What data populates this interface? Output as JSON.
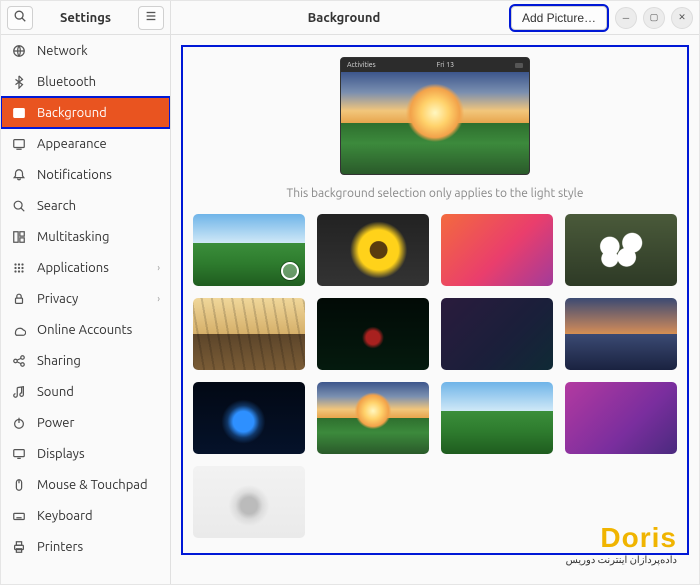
{
  "sidebar": {
    "title": "Settings",
    "items": [
      {
        "label": "Network",
        "icon": "network-icon"
      },
      {
        "label": "Bluetooth",
        "icon": "bluetooth-icon"
      },
      {
        "label": "Background",
        "icon": "background-icon",
        "selected": true
      },
      {
        "label": "Appearance",
        "icon": "appearance-icon"
      },
      {
        "label": "Notifications",
        "icon": "notifications-icon"
      },
      {
        "label": "Search",
        "icon": "search-icon"
      },
      {
        "label": "Multitasking",
        "icon": "multitasking-icon"
      },
      {
        "label": "Applications",
        "icon": "applications-icon",
        "has_submenu": true
      },
      {
        "label": "Privacy",
        "icon": "privacy-icon",
        "has_submenu": true
      },
      {
        "label": "Online Accounts",
        "icon": "online-accounts-icon"
      },
      {
        "label": "Sharing",
        "icon": "sharing-icon"
      },
      {
        "label": "Sound",
        "icon": "sound-icon"
      },
      {
        "label": "Power",
        "icon": "power-icon"
      },
      {
        "label": "Displays",
        "icon": "displays-icon"
      },
      {
        "label": "Mouse & Touchpad",
        "icon": "mouse-icon"
      },
      {
        "label": "Keyboard",
        "icon": "keyboard-icon"
      },
      {
        "label": "Printers",
        "icon": "printers-icon"
      }
    ]
  },
  "header": {
    "title": "Background",
    "add_picture_label": "Add Picture…"
  },
  "preview_bar": {
    "left": "Activities",
    "right": "Fri 13"
  },
  "hint_text": "This background selection only applies to the light style",
  "wallpapers": [
    {
      "name": "Green fields landscape",
      "css": "wp-landscape-green",
      "selected": true
    },
    {
      "name": "Sunflower macro",
      "css": "wp-sunflower"
    },
    {
      "name": "Orange pink gradient",
      "css": "wp-gradient-orange"
    },
    {
      "name": "White blossom",
      "css": "wp-blossom"
    },
    {
      "name": "Wooden road golden hour",
      "css": "wp-road"
    },
    {
      "name": "Ubuntu jellyfish dark",
      "css": "wp-jellyfish-dark"
    },
    {
      "name": "Dark purple gradient",
      "css": "wp-gradient-dark"
    },
    {
      "name": "Lake sunset reflection",
      "css": "wp-lake-sunset"
    },
    {
      "name": "Blue jellyfish",
      "css": "wp-jellyfish-blue"
    },
    {
      "name": "Sunset over valley",
      "css": "wp-sunset-valley"
    },
    {
      "name": "Green valley fields",
      "css": "wp-landscape-green"
    },
    {
      "name": "Pink purple gradient",
      "css": "wp-gradient-pink"
    },
    {
      "name": "Grey jellyfish light",
      "css": "wp-jellyfish-grey"
    }
  ],
  "watermark": {
    "logo": "Doris",
    "tagline": "داده‌پردازان اینترنت دوریس"
  }
}
